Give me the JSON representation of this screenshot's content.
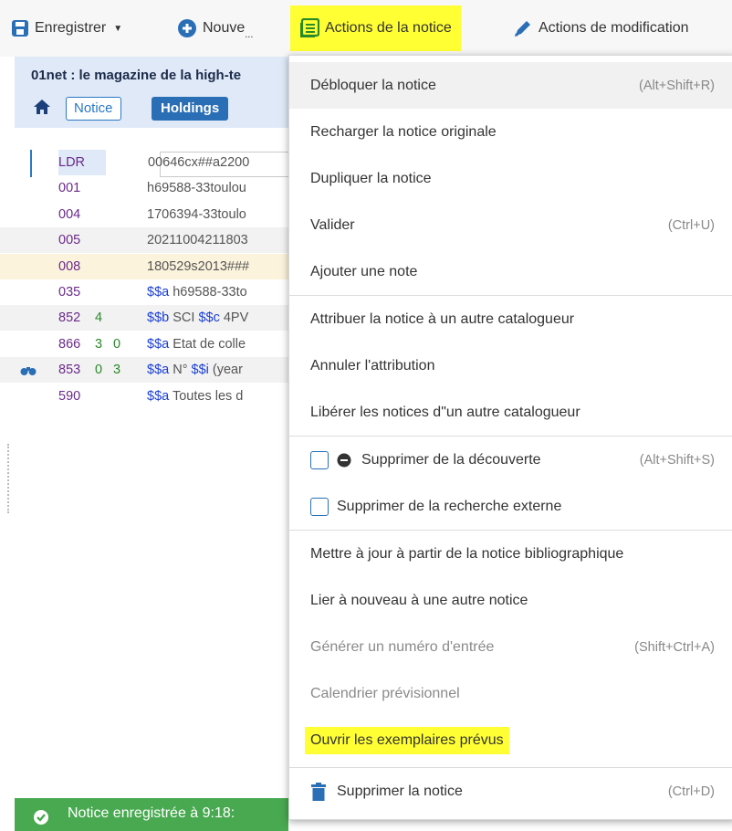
{
  "toolbar": {
    "save_label": "Enregistrer",
    "new_label": "Nouve",
    "new_more": "...",
    "record_actions_label": "Actions de la notice",
    "edit_actions_label": "Actions de modification"
  },
  "record": {
    "title": "01net : le magazine de la high-te",
    "tab_notice": "Notice",
    "tab_holdings": "Holdings",
    "rows": [
      {
        "tag": "LDR",
        "ind1": "",
        "ind2": "",
        "value": "00646cx##a2200"
      },
      {
        "tag": "001",
        "ind1": "",
        "ind2": "",
        "value": "h69588-33toulou"
      },
      {
        "tag": "004",
        "ind1": "",
        "ind2": "",
        "value": "1706394-33toulo"
      },
      {
        "tag": "005",
        "ind1": "",
        "ind2": "",
        "value": "20211004211803"
      },
      {
        "tag": "008",
        "ind1": "",
        "ind2": "",
        "value": "180529s2013###"
      },
      {
        "tag": "035",
        "ind1": "",
        "ind2": "",
        "sf1": "$$a",
        "value": " h69588-33to"
      },
      {
        "tag": "852",
        "ind1": "4",
        "ind2": "",
        "sf1": "$$b",
        "value": " SCI ",
        "sf2": "$$c",
        "value2": " 4PV"
      },
      {
        "tag": "866",
        "ind1": "3",
        "ind2": "0",
        "sf1": "$$a",
        "value": " Etat de colle"
      },
      {
        "tag": "853",
        "ind1": "0",
        "ind2": "3",
        "sf1": "$$a",
        "value": " N° ",
        "sf2": "$$i",
        "value2": " (year"
      },
      {
        "tag": "590",
        "ind1": "",
        "ind2": "",
        "sf1": "$$a",
        "value": " Toutes les d"
      }
    ]
  },
  "status": {
    "message": "Notice enregistrée à 9:18:"
  },
  "menu": {
    "items": [
      {
        "label": "Débloquer la notice",
        "shortcut": "(Alt+Shift+R)"
      },
      {
        "label": "Recharger la notice originale",
        "shortcut": ""
      },
      {
        "label": "Dupliquer la notice",
        "shortcut": ""
      },
      {
        "label": "Valider",
        "shortcut": "(Ctrl+U)"
      },
      {
        "label": "Ajouter une note",
        "shortcut": ""
      },
      {
        "label": "Attribuer la notice à un autre catalogueur",
        "shortcut": ""
      },
      {
        "label": "Annuler l'attribution",
        "shortcut": ""
      },
      {
        "label": "Libérer les notices d\"un autre catalogueur",
        "shortcut": ""
      },
      {
        "label": "Supprimer de la découverte",
        "shortcut": "(Alt+Shift+S)"
      },
      {
        "label": "Supprimer de la recherche externe",
        "shortcut": ""
      },
      {
        "label": "Mettre à jour à partir de la notice bibliographique",
        "shortcut": ""
      },
      {
        "label": "Lier à nouveau à une autre notice",
        "shortcut": ""
      },
      {
        "label": "Générer un numéro d'entrée",
        "shortcut": "(Shift+Ctrl+A)"
      },
      {
        "label": "Calendrier prévisionnel",
        "shortcut": ""
      },
      {
        "label": "Ouvrir les exemplaires prévus",
        "shortcut": ""
      },
      {
        "label": "Supprimer la notice",
        "shortcut": "(Ctrl+D)"
      }
    ]
  },
  "colors": {
    "accent": "#2a6fb5",
    "highlight": "#ffff33",
    "status_green": "#48a950",
    "tag_purple": "#6a2a8a",
    "subfield_blue": "#1a3fd4"
  }
}
